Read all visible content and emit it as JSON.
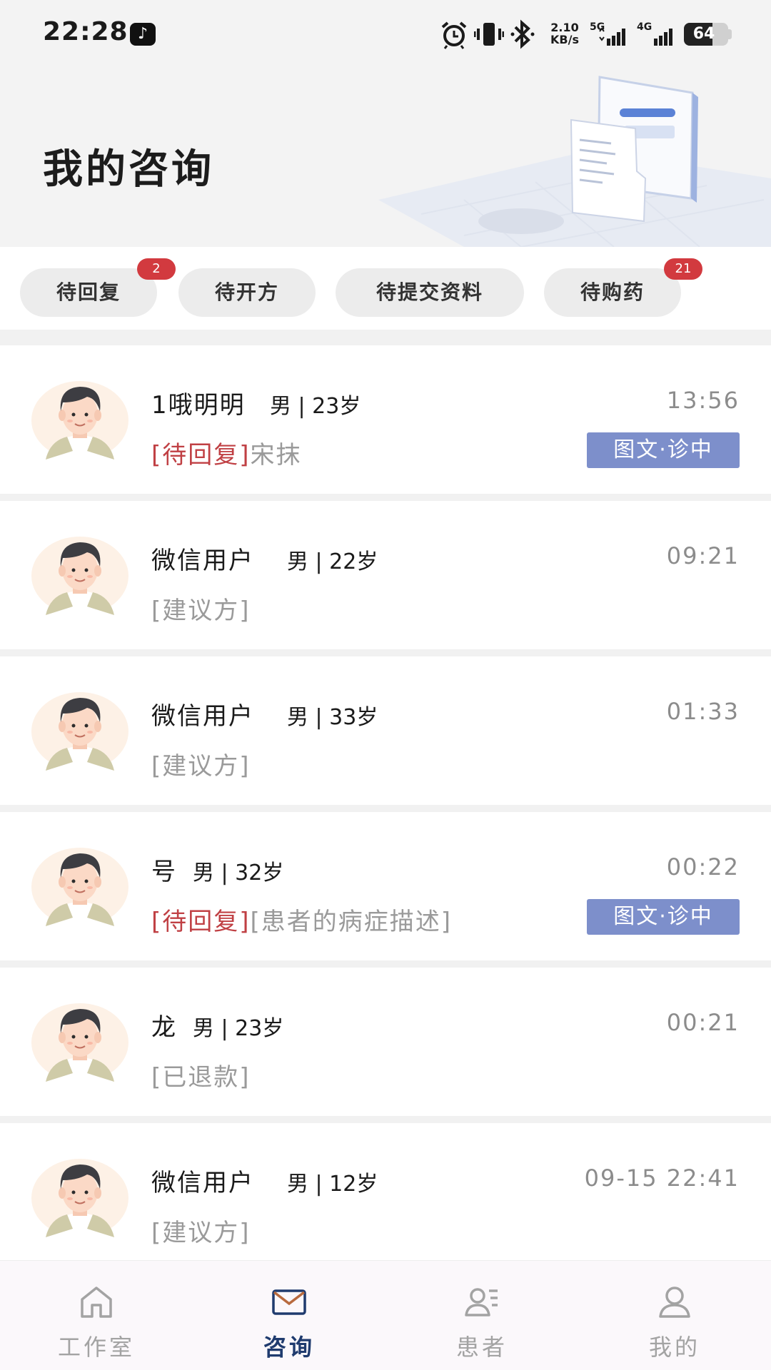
{
  "status_bar": {
    "time": "22:28",
    "app_icon": "tiktok-icon",
    "speed_top": "2.10",
    "speed_bottom": "KB/s",
    "net1": "5G",
    "net2": "4G",
    "battery": "64",
    "battery_level_percent": 64
  },
  "header": {
    "title": "我的咨询"
  },
  "filters": [
    {
      "label": "待回复",
      "badge": "2"
    },
    {
      "label": "待开方",
      "badge": ""
    },
    {
      "label": "待提交资料",
      "badge": ""
    },
    {
      "label": "待购药",
      "badge": "21"
    }
  ],
  "consultations": [
    {
      "name": "1哦明明",
      "meta": "男 | 23岁",
      "time": "13:56",
      "status": "[待回复]",
      "detail": "宋抹",
      "tag": "图文·诊中"
    },
    {
      "name": "微信用户",
      "meta": "男 | 22岁",
      "time": "09:21",
      "status": "",
      "detail": "[建议方]",
      "tag": ""
    },
    {
      "name": "微信用户",
      "meta": "男 | 33岁",
      "time": "01:33",
      "status": "",
      "detail": "[建议方]",
      "tag": ""
    },
    {
      "name": "号",
      "meta": "男 | 32岁",
      "time": "00:22",
      "status": "[待回复]",
      "detail": "[患者的病症描述]",
      "tag": "图文·诊中"
    },
    {
      "name": "龙",
      "meta": "男 | 23岁",
      "time": "00:21",
      "status": "",
      "detail": "[已退款]",
      "tag": ""
    },
    {
      "name": "微信用户",
      "meta": "男 | 12岁",
      "time": "09-15 22:41",
      "status": "",
      "detail": "[建议方]",
      "tag": ""
    }
  ],
  "bottom_nav": [
    {
      "label": "工作室",
      "icon": "home-icon",
      "active": false
    },
    {
      "label": "咨询",
      "icon": "mail-icon",
      "active": true
    },
    {
      "label": "患者",
      "icon": "patients-icon",
      "active": false
    },
    {
      "label": "我的",
      "icon": "profile-icon",
      "active": false
    }
  ],
  "colors": {
    "accent": "#1f3b6e",
    "pending_red": "#c04044",
    "badge_red": "#d23a3f",
    "tag_blue": "#7d8fcb"
  }
}
